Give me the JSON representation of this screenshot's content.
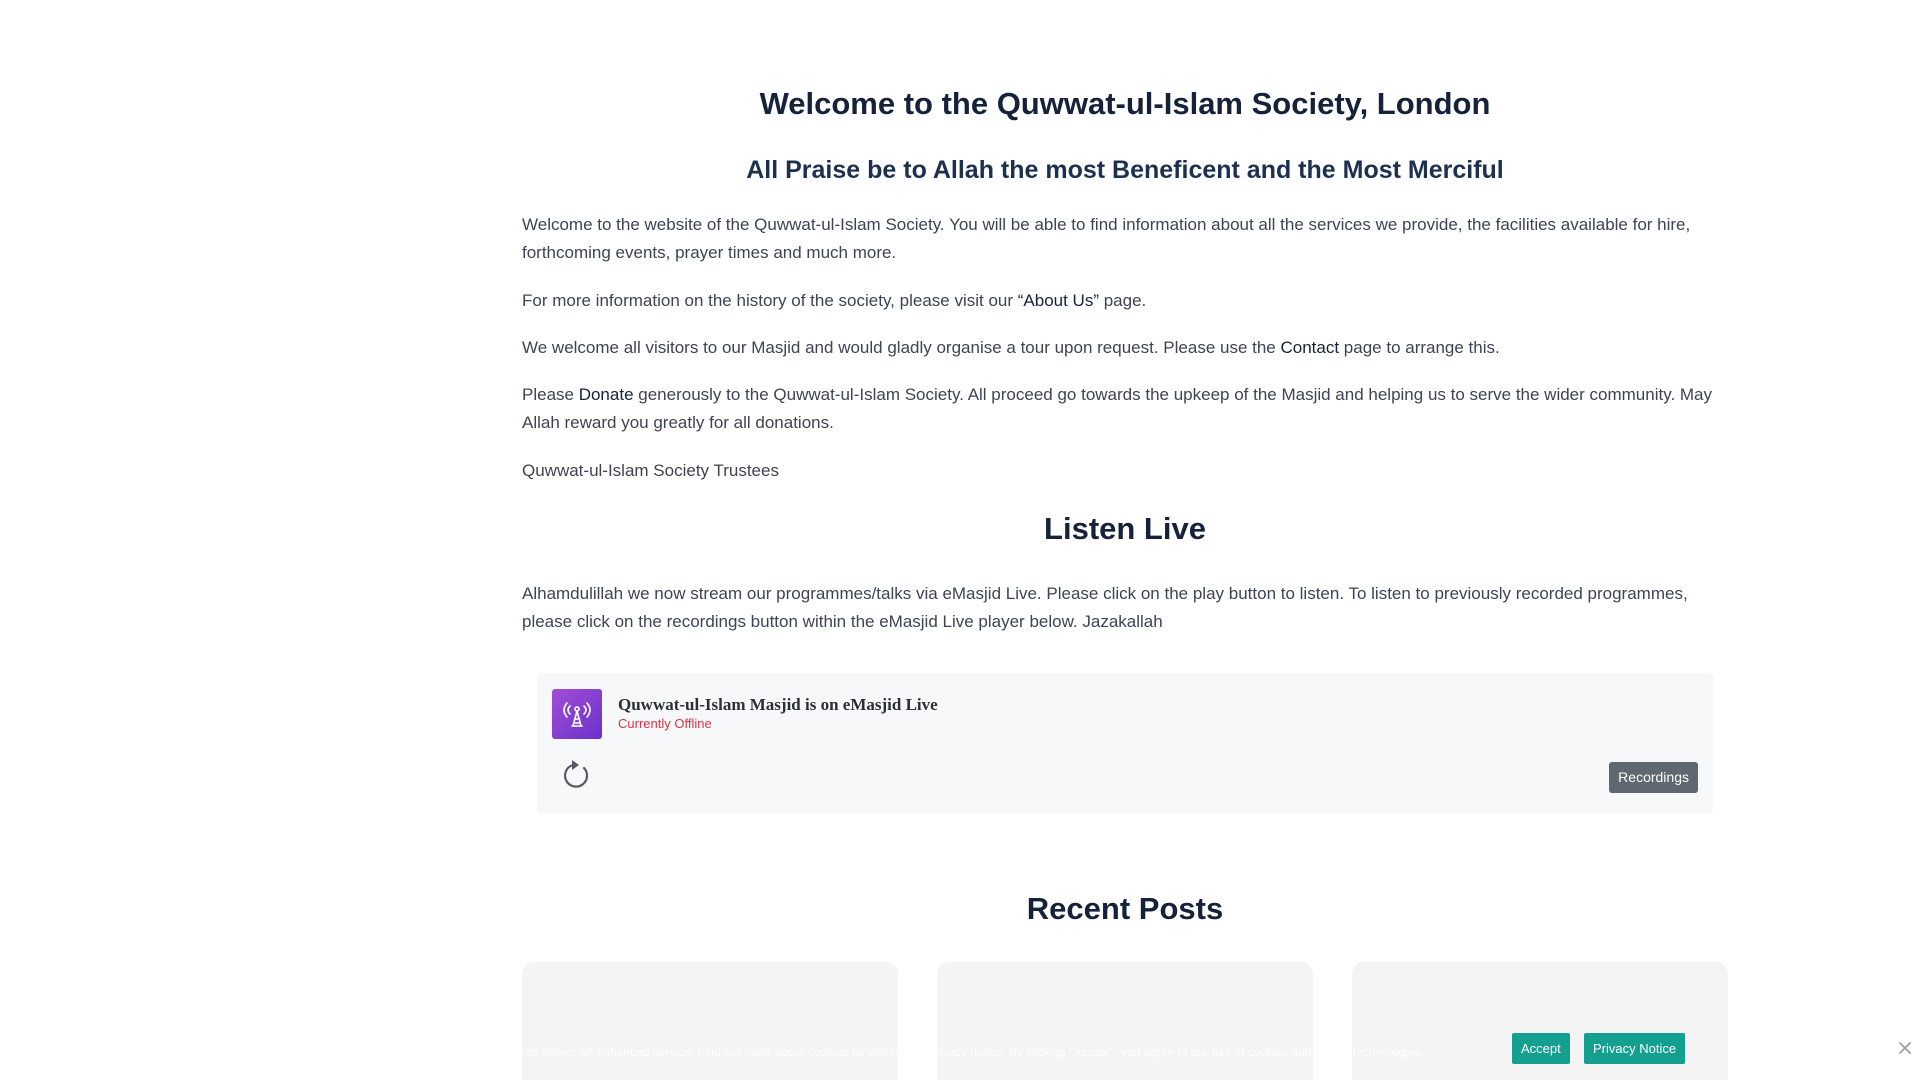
{
  "welcome": {
    "title": "Welcome to the Quwwat-ul-Islam Society, London",
    "subtitle": "All Praise be to Allah the most Beneficent and the Most Merciful",
    "para1": "Welcome to the website of the Quwwat-ul-Islam Society. You will be able to find information about all the services we provide, the facilities available for hire, forthcoming events, prayer times and much more.",
    "para2_before": "For more information on the history of the society, please visit our ",
    "para2_link": "“About Us”",
    "para2_after": " page.",
    "para3_before": "We welcome all visitors to our Masjid and would gladly organise a tour upon request. Please use the ",
    "para3_link": "Contact",
    "para3_after": " page to arrange this.",
    "para4_before": "Please ",
    "para4_link": "Donate",
    "para4_after": " generously to the Quwwat-ul-Islam Society. All proceed go towards the upkeep of the Masjid and helping us to serve the wider community. May Allah reward you greatly for all donations.",
    "signature": "Quwwat-ul-Islam Society Trustees"
  },
  "listen_live": {
    "title": "Listen Live",
    "description": "Alhamdulillah we now stream our programmes/talks via eMasjid Live. Please click on the play button to listen. To listen to previously recorded programmes, please click on the recordings button within the eMasjid Live player below. Jazakallah"
  },
  "player": {
    "logo_icon": "broadcast-tower-icon",
    "title": "Quwwat-ul-Islam Masjid is on eMasjid Live",
    "status": "Currently Offline",
    "status_color": "#dc3545",
    "logo_color": "#8a40d4",
    "refresh_icon": "refresh-icon",
    "recordings_label": "Recordings"
  },
  "recent_posts": {
    "title": "Recent Posts",
    "cards": [
      {
        "name": "post-card-1"
      },
      {
        "name": "post-card-2"
      },
      {
        "name": "post-card-3"
      }
    ]
  },
  "cookie_notice": {
    "text": "…to deliver an enhanced service. Find out more about cookies by visiting our privacy notice. By clicking \"Accept\", you agree to our use of cookies and similar technologies.",
    "accept_label": "Accept",
    "privacy_label": "Privacy Notice",
    "button_color": "#13a08f",
    "close_icon": "close-icon"
  }
}
